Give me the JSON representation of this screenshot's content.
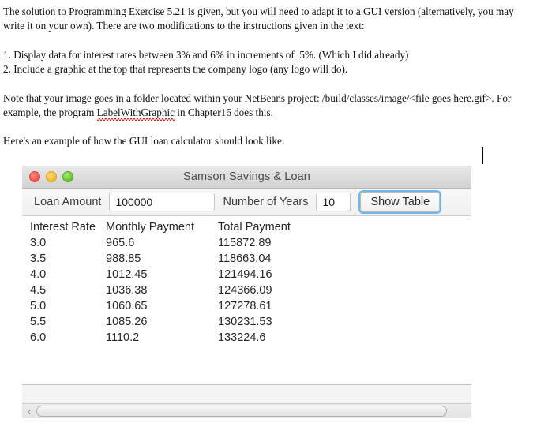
{
  "document": {
    "paragraphs": [
      "The solution to Programming Exercise 5.21 is given, but you will need to adapt it to a GUI version (alternatively, you may write it on your own). There are two modifications to the instructions given in the text:",
      "1. Display data for interest rates between 3% and 6% in increments of .5%. (Which I did already)",
      "2. Include a graphic at the top that represents the company logo (any logo will do).",
      "Here's an example of how the GUI loan calculator should look like:"
    ],
    "note_before_misspelled": "Note that your image goes in a folder located within your NetBeans project: /build/classes/image/<file goes here.gif>.  For example, the program ",
    "misspelled_word": "LabelWithGraphic",
    "note_after_misspelled": " in Chapter16 does this."
  },
  "window": {
    "title": "Samson Savings & Loan",
    "traffic_lights": [
      {
        "name": "close",
        "color": "#f05046"
      },
      {
        "name": "minimize",
        "color": "#f3b823"
      },
      {
        "name": "zoom",
        "color": "#63c327"
      }
    ]
  },
  "toolbar": {
    "loan_amount_label": "Loan Amount",
    "loan_amount_value": "100000",
    "loan_amount_placeholder": "",
    "years_label": "Number of Years",
    "years_value": "10",
    "years_placeholder": "",
    "show_table_label": "Show Table",
    "focus_ring_color": "#6fb6ea"
  },
  "table": {
    "headers": [
      "Interest Rate",
      "Monthly Payment",
      "Total Payment"
    ],
    "rows": [
      [
        "3.0",
        "965.6",
        "115872.89"
      ],
      [
        "3.5",
        "988.85",
        "118663.04"
      ],
      [
        "4.0",
        "1012.45",
        "121494.16"
      ],
      [
        "4.5",
        "1036.38",
        "124366.09"
      ],
      [
        "5.0",
        "1060.65",
        "127278.61"
      ],
      [
        "5.5",
        "1085.26",
        "130231.53"
      ],
      [
        "6.0",
        "1110.2",
        "133224.6"
      ]
    ]
  },
  "scrollbar": {
    "left_arrow_glyph": "‹",
    "orientation": "horizontal"
  }
}
